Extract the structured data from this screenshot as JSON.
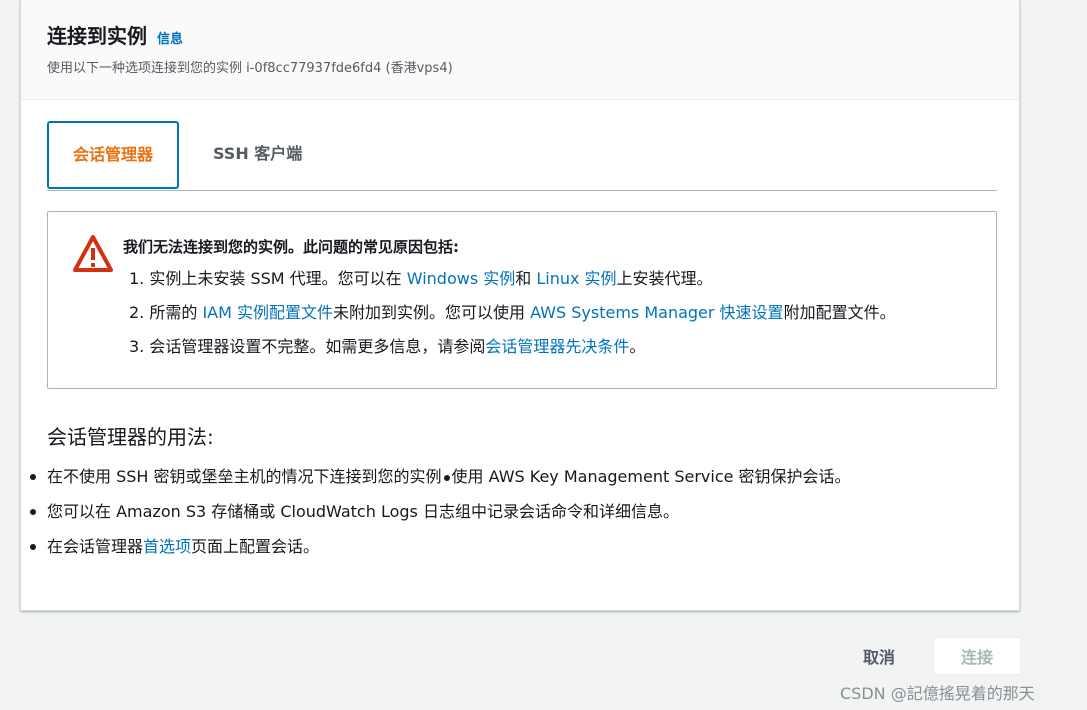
{
  "header": {
    "title": "连接到实例",
    "info_link": "信息",
    "subtitle": "使用以下一种选项连接到您的实例 i-0f8cc77937fde6fd4 (香港vps4)"
  },
  "tabs": [
    {
      "label": "会话管理器",
      "active": true
    },
    {
      "label": "SSH 客户端",
      "active": false
    }
  ],
  "alert": {
    "icon": "warning-triangle-icon",
    "color": "#d13212",
    "title": "我们无法连接到您的实例。此问题的常见原因包括:",
    "items": [
      {
        "p1": "1. 实例上未安装 SSM 代理。您可以在 ",
        "link1": "Windows 实例",
        "p2": "和 ",
        "link2": "Linux 实例",
        "p3": "上安装代理。"
      },
      {
        "p1": "2. 所需的 ",
        "link1": "IAM 实例配置文件",
        "p2": "未附加到实例。您可以使用 ",
        "link2": "AWS Systems Manager 快速设置",
        "p3": "附加配置文件。"
      },
      {
        "p1": "3. 会话管理器设置不完整。如需更多信息，请参阅",
        "link1": "会话管理器先决条件",
        "p2": "。"
      }
    ]
  },
  "usage": {
    "title": "会话管理器的用法:",
    "item1_a": "在不使用 SSH 密钥或堡垒主机的情况下连接到您的实例",
    "item1_b": "使用 AWS Key Management Service 密钥保护会话。",
    "item2": "您可以在 Amazon S3 存储桶或 CloudWatch Logs 日志组中记录会话命令和详细信息。",
    "item3_a": "在会话管理器",
    "item3_link": "首选项",
    "item3_b": "页面上配置会话。"
  },
  "footer": {
    "cancel_label": "取消",
    "connect_label": "连接"
  },
  "watermark": "CSDN @記億搖晃着的那天",
  "colors": {
    "accent": "#ec7211",
    "link": "#0073bb",
    "warning": "#d13212"
  }
}
